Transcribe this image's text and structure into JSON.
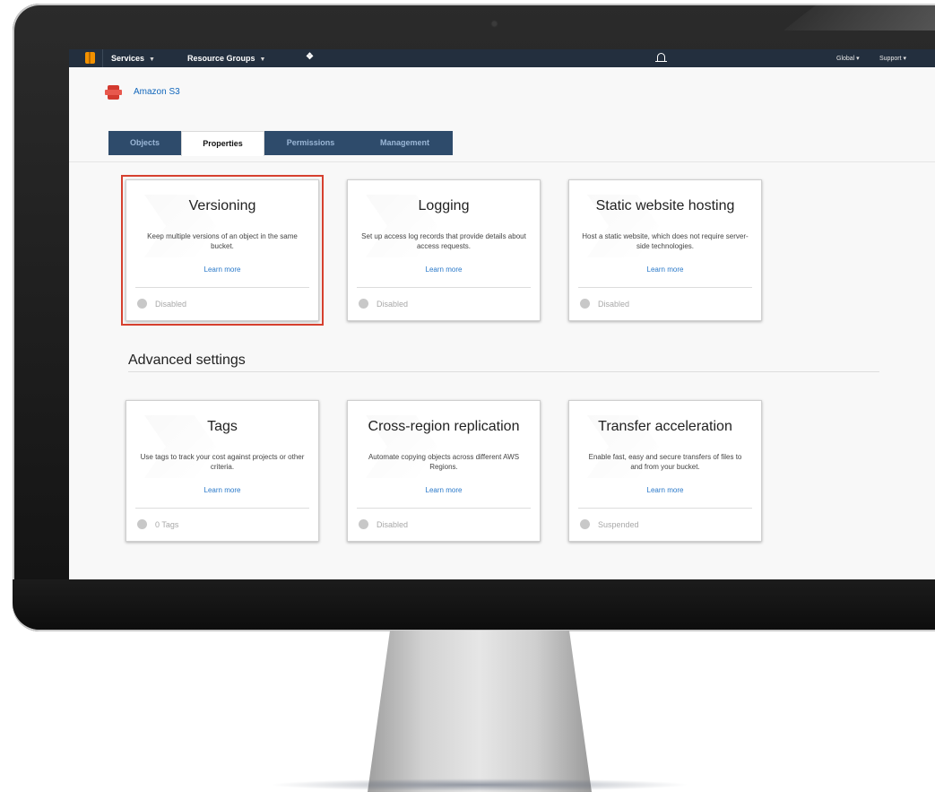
{
  "topnav": {
    "services": "Services",
    "resource_groups": "Resource Groups",
    "region": "Global",
    "support": "Support"
  },
  "service": {
    "breadcrumb": "Amazon S3"
  },
  "tabs": [
    {
      "label": "Objects",
      "active": false
    },
    {
      "label": "Properties",
      "active": true
    },
    {
      "label": "Permissions",
      "active": false
    },
    {
      "label": "Management",
      "active": false
    }
  ],
  "cards": [
    {
      "title": "Versioning",
      "description": "Keep multiple versions of an object in the same bucket.",
      "link": "Learn more",
      "status": "Disabled"
    },
    {
      "title": "Logging",
      "description": "Set up access log records that provide details about access requests.",
      "link": "Learn more",
      "status": "Disabled"
    },
    {
      "title": "Static website hosting",
      "description": "Host a static website, which does not require server-side technologies.",
      "link": "Learn more",
      "status": "Disabled"
    }
  ],
  "advanced": {
    "heading": "Advanced settings",
    "cards": [
      {
        "title": "Tags",
        "description": "Use tags to track your cost against projects or other criteria.",
        "link": "Learn more",
        "status": "0 Tags"
      },
      {
        "title": "Cross-region replication",
        "description": "Automate copying objects across different AWS Regions.",
        "link": "Learn more",
        "status": "Disabled"
      },
      {
        "title": "Transfer acceleration",
        "description": "Enable fast, easy and secure transfers of files to and from your bucket.",
        "link": "Learn more",
        "status": "Suspended"
      }
    ]
  },
  "colors": {
    "nav_bg": "#232f3e",
    "tab_bg": "#2e4b6b",
    "link": "#2a79c9",
    "highlight": "#d6402f"
  }
}
